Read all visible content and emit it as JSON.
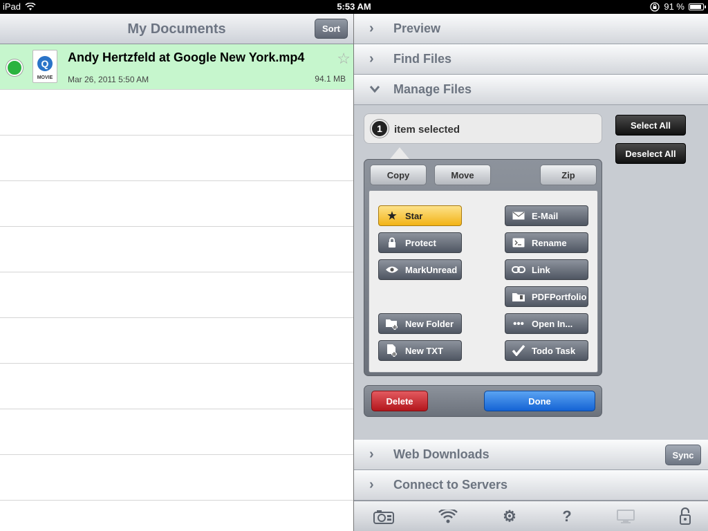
{
  "status_bar": {
    "device": "iPad",
    "time": "5:53 AM",
    "battery": "91 %",
    "battery_level": 0.91
  },
  "documents": {
    "title": "My Documents",
    "sort_label": "Sort",
    "files": [
      {
        "name": "Andy Hertzfeld at Google New York.mp4",
        "date": "Mar 26, 2011 5:50 AM",
        "size": "94.1 MB",
        "icon_label": "MOVIE",
        "icon": "quicktime-movie-icon"
      }
    ]
  },
  "sections": {
    "preview": "Preview",
    "find_files": "Find Files",
    "manage_files": "Manage Files",
    "web_downloads": "Web Downloads",
    "connect_servers": "Connect to Servers",
    "sync_label": "Sync"
  },
  "manage": {
    "selected_count": "1",
    "selected_text": "item selected",
    "select_all": "Select All",
    "deselect_all": "Deselect All",
    "copy": "Copy",
    "move": "Move",
    "zip": "Zip",
    "star": "Star",
    "email": "E-Mail",
    "protect": "Protect",
    "rename": "Rename",
    "mark_unread": "MarkUnread",
    "link": "Link",
    "pdf_portfolio": "PDFPortfolio",
    "new_folder": "New Folder",
    "open_in": "Open In...",
    "new_txt": "New TXT",
    "todo_task": "Todo Task",
    "delete": "Delete",
    "done": "Done"
  },
  "toolbar": {
    "icons": [
      "camera-icon",
      "wifi-icon",
      "gear-icon",
      "help-icon",
      "monitor-icon",
      "lock-icon"
    ]
  },
  "colors": {
    "selected_row": "#c6f6cd",
    "status_dot": "#2bb340",
    "star_button": "#f2b316",
    "delete_button": "#b3161c",
    "done_button": "#1463d4"
  }
}
